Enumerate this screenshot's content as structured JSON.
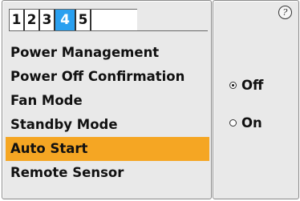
{
  "tabs": [
    {
      "label": "1",
      "active": false
    },
    {
      "label": "2",
      "active": false
    },
    {
      "label": "3",
      "active": false
    },
    {
      "label": "4",
      "active": true
    },
    {
      "label": "5",
      "active": false
    }
  ],
  "menu": {
    "items": [
      {
        "label": "Power Management",
        "selected": false
      },
      {
        "label": "Power Off Confirmation",
        "selected": false
      },
      {
        "label": "Fan Mode",
        "selected": false
      },
      {
        "label": "Standby Mode",
        "selected": false
      },
      {
        "label": "Auto Start",
        "selected": true
      },
      {
        "label": "Remote Sensor",
        "selected": false
      }
    ],
    "selected_color": "#f5a623"
  },
  "options": {
    "items": [
      {
        "label": "Off",
        "checked": true
      },
      {
        "label": "On",
        "checked": false
      }
    ]
  },
  "help": {
    "icon": "question-icon",
    "glyph": "?"
  },
  "colors": {
    "active_tab": "#2aa0f0",
    "panel_bg": "#e9e9e9"
  }
}
